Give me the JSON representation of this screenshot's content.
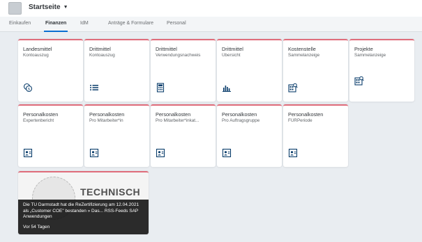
{
  "header": {
    "app_title": "Startseite"
  },
  "tabs": [
    {
      "label": "Einkaufen"
    },
    {
      "label": "Finanzen"
    },
    {
      "label": "IdM"
    },
    {
      "label": "Anträge & Formulare"
    },
    {
      "label": "Personal"
    }
  ],
  "tiles": [
    {
      "title": "Landesmittel",
      "subtitle": "Kontoauszug",
      "icon": "money-bills-icon"
    },
    {
      "title": "Drittmittel",
      "subtitle": "Kontoauszug",
      "icon": "list-icon"
    },
    {
      "title": "Drittmittel",
      "subtitle": "Verwendungsnachweis",
      "icon": "calculator-icon"
    },
    {
      "title": "Drittmittel",
      "subtitle": "Übersicht",
      "icon": "bar-chart-icon"
    },
    {
      "title": "Kostenstelle",
      "subtitle": "Sammelanzeige",
      "icon": "table-search-icon"
    },
    {
      "title": "Projekte",
      "subtitle": "Sammelanzeige",
      "icon": "table-search-icon"
    },
    {
      "title": "Personalkosten",
      "subtitle": "Expertenbericht",
      "icon": "employee-card-icon"
    },
    {
      "title": "Personalkosten",
      "subtitle": "Pro Mitarbeiter*in",
      "icon": "employee-card-icon"
    },
    {
      "title": "Personalkosten",
      "subtitle": "Pro Mitarbeiter*inkat...",
      "icon": "employee-card-icon"
    },
    {
      "title": "Personalkosten",
      "subtitle": "Pro Auftragsgruppe",
      "icon": "employee-card-icon"
    },
    {
      "title": "Personalkosten",
      "subtitle": "FÜRPeriode",
      "icon": "employee-card-icon"
    }
  ],
  "news": {
    "brand_text": "TECHNISCH",
    "text": "Die TU Darmstadt hat die ReZertifizierung am 12.04.2021 als „Customer COE\" bestanden » Das... RSS-Feeds SAP Anwendungen",
    "time": "Vor 54 Tagen"
  },
  "colors": {
    "accent": "#0a6ed1",
    "tile_top_border": "#e06c7a",
    "icon": "#0a3d6b",
    "background": "#e9edf1"
  }
}
